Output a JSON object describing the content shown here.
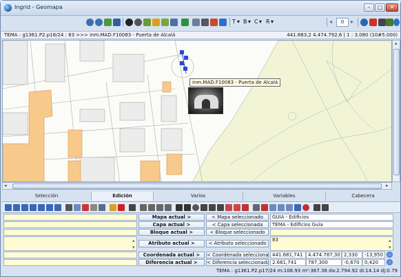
{
  "window": {
    "title": "Ingrid - Geomapa"
  },
  "toolbar": {
    "t_label": "T",
    "b_label": "B",
    "c_label": "C",
    "r_label": "R",
    "zoom_value": "0"
  },
  "infobar": {
    "left": "TEMA : g1361.P2.p18/24 : 83 >>> inm.MAD.F10083 - Puerta de Alcalá",
    "right": "441.683,2 4.474.792,6 | 1 : 3.080 (10#5.000)"
  },
  "map": {
    "tooltip": "inm.MAD.F10083 - Puerta de Alcalá",
    "colors": {
      "building": "#f7c98b",
      "park": "#f2f4d6",
      "block": "#e8e8e8"
    }
  },
  "tabs": [
    "Selección",
    "Edición",
    "Varios",
    "Variables",
    "Cabecera"
  ],
  "form": {
    "mapa_label": "Mapa actual >",
    "mapa_action": "< Mapa seleccionado",
    "mapa_value": "GUIA - Edificios",
    "capa_label": "Capa actual >",
    "capa_action": "< Capa seleccionada",
    "capa_value": "TEMA - Edificios Guía",
    "bloque_label": "Bloque actual >",
    "bloque_action": "< Bloque seleccionado",
    "atributo_label": "Atributo actual >",
    "atributo_action": "< Atributo seleccionado",
    "atributo_value": "83",
    "coord_label": "Coordenada actual >",
    "coord_action": "< Coordenada selecciona...",
    "coord_x": "441.681,741",
    "coord_y": "4.474.787,30",
    "coord_z": "2,330",
    "coord_w": "-13,950",
    "diff_label": "Diferencia actual >",
    "diff_action": "< Diferencia seleccionada",
    "diff_x": "2.681,741",
    "diff_y": "787,300",
    "diff_z": "-0,670",
    "diff_w": "0,420"
  },
  "status": "TEMA : g1361.P2.p17/24  m:108.93 m²:367.38 da:2.794.92 di:14.14 dj:0.79"
}
